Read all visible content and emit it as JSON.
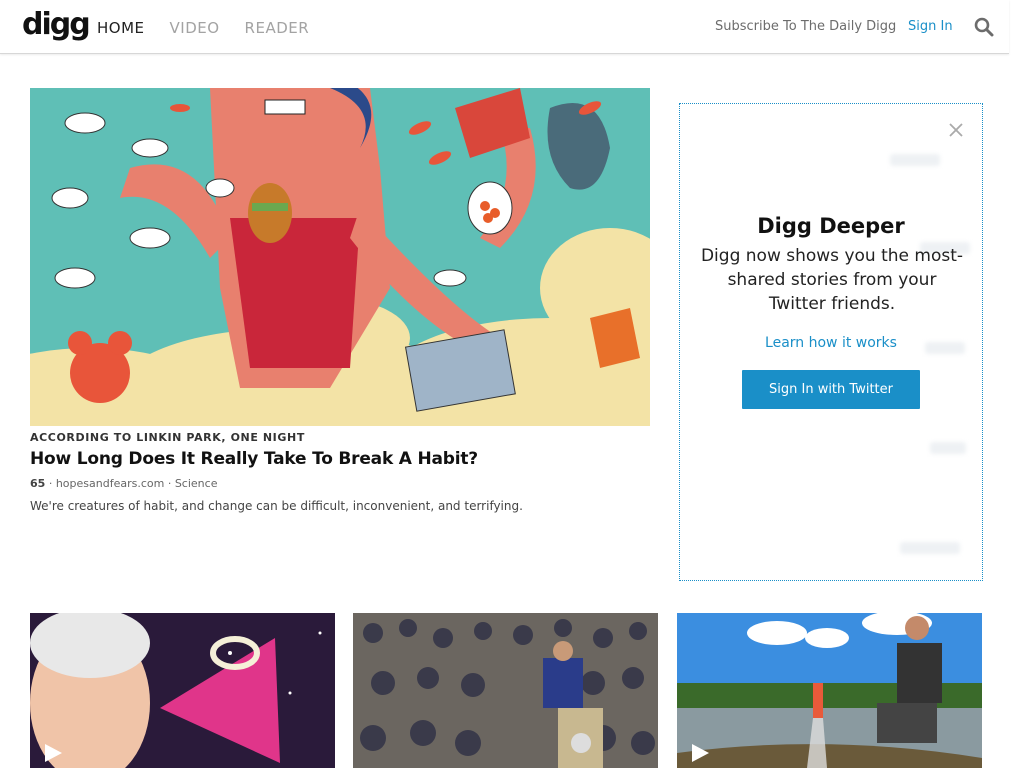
{
  "header": {
    "logo": "digg",
    "nav": [
      "HOME",
      "VIDEO",
      "READER"
    ],
    "subscribe": "Subscribe To The Daily Digg",
    "signin": "Sign In"
  },
  "hero": {
    "kicker": "ACCORDING TO LINKIN PARK, ONE NIGHT",
    "headline": "How Long Does It Really Take To Break A Habit?",
    "count": "65",
    "source": "hopesandfears.com",
    "category": "Science",
    "description": "We're creatures of habit, and change can be difficult, inconvenient, and terrifying.",
    "image_icon": "illustration-woman-eating"
  },
  "promo": {
    "title": "Digg Deeper",
    "text": "Digg now shows you the most-shared stories from your Twitter friends.",
    "link": "Learn how it works",
    "button": "Sign In with Twitter",
    "accent": "#1a8fc8"
  },
  "cards": [
    {
      "image": "older-woman-cosmic-triangle",
      "icon": "play-icon"
    },
    {
      "image": "crowd-airport-security",
      "icon": "none"
    },
    {
      "image": "man-launching-rocket-lake",
      "icon": "play-icon"
    }
  ]
}
